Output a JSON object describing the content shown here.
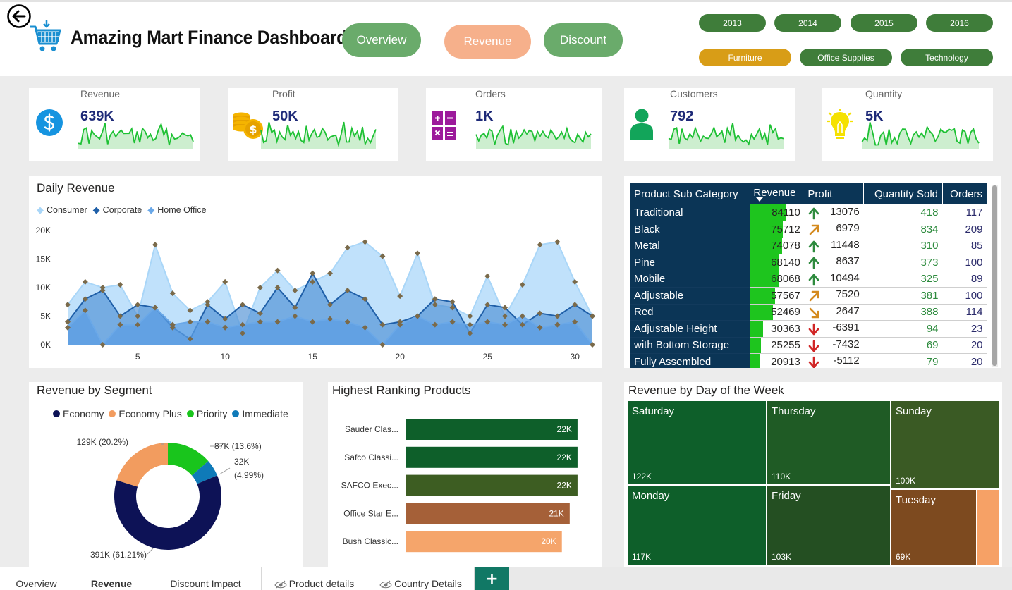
{
  "header": {
    "title": "Amazing Mart Finance Dashboard",
    "nav": [
      {
        "label": "Overview",
        "color": "#6aab6b"
      },
      {
        "label": "Revenue",
        "color": "#f6b08b"
      },
      {
        "label": "Discount",
        "color": "#6aab6b"
      }
    ],
    "years": [
      "2013",
      "2014",
      "2015",
      "2016"
    ],
    "categories": [
      {
        "label": "Furniture",
        "selected": true
      },
      {
        "label": "Office Supplies",
        "selected": false
      },
      {
        "label": "Technology",
        "selected": false
      }
    ],
    "colors": {
      "year_pill": "#3f7d3a",
      "cat_selected": "#d89d17",
      "cat_default": "#3f7d3a"
    }
  },
  "kpis": [
    {
      "label": "Revenue",
      "value": "639K",
      "icon": "dollar-icon"
    },
    {
      "label": "Profit",
      "value": "50K",
      "icon": "coins-icon"
    },
    {
      "label": "Orders",
      "value": "1K",
      "icon": "calculator-icon"
    },
    {
      "label": "Customers",
      "value": "792",
      "icon": "person-icon"
    },
    {
      "label": "Quantity",
      "value": "5K",
      "icon": "lightbulb-icon"
    }
  ],
  "daily_revenue": {
    "title": "Daily Revenue",
    "chart_data": {
      "type": "area",
      "title": "Daily Revenue",
      "x": [
        1,
        2,
        3,
        4,
        5,
        6,
        7,
        8,
        9,
        10,
        11,
        12,
        13,
        14,
        15,
        16,
        17,
        18,
        19,
        20,
        21,
        22,
        23,
        24,
        25,
        26,
        27,
        28,
        29,
        30,
        31
      ],
      "xticks": [
        "5",
        "10",
        "15",
        "20",
        "25",
        "30"
      ],
      "yticks": [
        "0K",
        "5K",
        "10K",
        "15K",
        "20K"
      ],
      "ylim": [
        0,
        20000
      ],
      "grid": false,
      "legend_position": "top-left",
      "series": [
        {
          "name": "Consumer",
          "color": "#a9d6f8",
          "values": [
            7000,
            11000,
            10000,
            10500,
            5000,
            17500,
            9000,
            6000,
            7500,
            11000,
            2000,
            10000,
            13000,
            9500,
            11000,
            12500,
            17000,
            18000,
            15500,
            8500,
            16000,
            7000,
            6500,
            5000,
            12000,
            5000,
            10500,
            17500,
            18000,
            11000,
            5000
          ]
        },
        {
          "name": "Corporate",
          "color": "#1f5fa8",
          "values": [
            4000,
            8000,
            9500,
            5000,
            7000,
            6500,
            3000,
            1000,
            7000,
            4500,
            7000,
            5500,
            10000,
            6500,
            12500,
            7000,
            9500,
            8000,
            3500,
            4000,
            5000,
            8000,
            7500,
            2000,
            7000,
            6500,
            3500,
            5500,
            5000,
            7000,
            5000
          ]
        },
        {
          "name": "Home Office",
          "color": "#6aa8e8",
          "values": [
            3000,
            6000,
            0,
            3500,
            3500,
            6500,
            3500,
            4000,
            4000,
            3000,
            3500,
            4000,
            4000,
            5000,
            4000,
            4500,
            4000,
            3000,
            0,
            3500,
            5000,
            3500,
            4000,
            3500,
            4000,
            3500,
            5000,
            3000,
            3500,
            4000,
            0
          ]
        }
      ]
    }
  },
  "subcategory_table": {
    "columns": [
      "Product Sub Category",
      "Revenue",
      "Profit",
      "Quantity Sold",
      "Orders"
    ],
    "rows": [
      {
        "name": "Traditional",
        "revenue": "84110",
        "revenue_num": 84110,
        "trend": "up",
        "profit": "13076",
        "qty": "418",
        "orders": "117"
      },
      {
        "name": "Black",
        "revenue": "75712",
        "revenue_num": 75712,
        "trend": "up-right",
        "profit": "6979",
        "qty": "834",
        "orders": "209"
      },
      {
        "name": "Metal",
        "revenue": "74078",
        "revenue_num": 74078,
        "trend": "up",
        "profit": "11448",
        "qty": "310",
        "orders": "85"
      },
      {
        "name": "Pine",
        "revenue": "68140",
        "revenue_num": 68140,
        "trend": "up",
        "profit": "8637",
        "qty": "373",
        "orders": "100"
      },
      {
        "name": "Mobile",
        "revenue": "68068",
        "revenue_num": 68068,
        "trend": "up",
        "profit": "10494",
        "qty": "325",
        "orders": "89"
      },
      {
        "name": "Adjustable",
        "revenue": "57567",
        "revenue_num": 57567,
        "trend": "up-right",
        "profit": "7520",
        "qty": "381",
        "orders": "100"
      },
      {
        "name": "Red",
        "revenue": "52469",
        "revenue_num": 52469,
        "trend": "down-right",
        "profit": "2647",
        "qty": "388",
        "orders": "114"
      },
      {
        "name": "Adjustable Height",
        "revenue": "30363",
        "revenue_num": 30363,
        "trend": "down",
        "profit": "-6391",
        "qty": "94",
        "orders": "23"
      },
      {
        "name": "with Bottom Storage",
        "revenue": "25255",
        "revenue_num": 25255,
        "trend": "down",
        "profit": "-7432",
        "qty": "69",
        "orders": "20"
      },
      {
        "name": "Fully Assembled",
        "revenue": "20913",
        "revenue_num": 20913,
        "trend": "down",
        "profit": "-5112",
        "qty": "79",
        "orders": "20"
      }
    ]
  },
  "segment": {
    "title": "Revenue by Segment",
    "chart_data": {
      "type": "pie",
      "title": "Revenue by Segment",
      "legend_position": "top",
      "slices": [
        {
          "name": "Economy",
          "value": 391,
          "label": "391K (61.21%)",
          "color": "#0d1256"
        },
        {
          "name": "Economy Plus",
          "value": 129,
          "label": "129K (20.2%)",
          "color": "#f29c5f"
        },
        {
          "name": "Priority",
          "value": 87,
          "label": "87K (13.6%)",
          "color": "#19c51c"
        },
        {
          "name": "Immediate",
          "value": 32,
          "label_value": "32K",
          "label_pct": "(4.99%)",
          "color": "#0f7ab8"
        }
      ]
    }
  },
  "ranking": {
    "title": "Highest Ranking Products",
    "chart_data": {
      "type": "bar",
      "title": "Highest Ranking Products",
      "orientation": "horizontal",
      "categories": [
        "Sauder Clas...",
        "Safco Classi...",
        "SAFCO Exec...",
        "Office Star E...",
        "Bush Classic..."
      ],
      "values": [
        22,
        22,
        22,
        21,
        20
      ],
      "value_labels": [
        "22K",
        "22K",
        "22K",
        "21K",
        "20K"
      ],
      "colors": [
        "#0e5f2a",
        "#0e5f2a",
        "#3d5d22",
        "#a56038",
        "#f5a56b"
      ],
      "xlim": [
        0,
        23
      ]
    }
  },
  "weekday": {
    "title": "Revenue by Day of the Week",
    "cells": [
      {
        "day": "Saturday",
        "value": "122K",
        "color": "#0e5f2a"
      },
      {
        "day": "Thursday",
        "value": "110K",
        "color": "#1f5b25"
      },
      {
        "day": "Sunday",
        "value": "100K",
        "color": "#3a5a24"
      },
      {
        "day": "Monday",
        "value": "117K",
        "color": "#0e5f2a"
      },
      {
        "day": "Friday",
        "value": "103K",
        "color": "#244f22"
      },
      {
        "day": "Tuesday",
        "value": "69K",
        "color": "#7d4a1f"
      }
    ],
    "extra_color": "#f6a166"
  },
  "tabs": [
    {
      "label": "Overview",
      "hidden": false
    },
    {
      "label": "Revenue",
      "hidden": false,
      "active": true
    },
    {
      "label": "Discount Impact",
      "hidden": false
    },
    {
      "label": "Product details",
      "hidden": true
    },
    {
      "label": "Country Details",
      "hidden": true
    }
  ],
  "add_tab_label": "+"
}
